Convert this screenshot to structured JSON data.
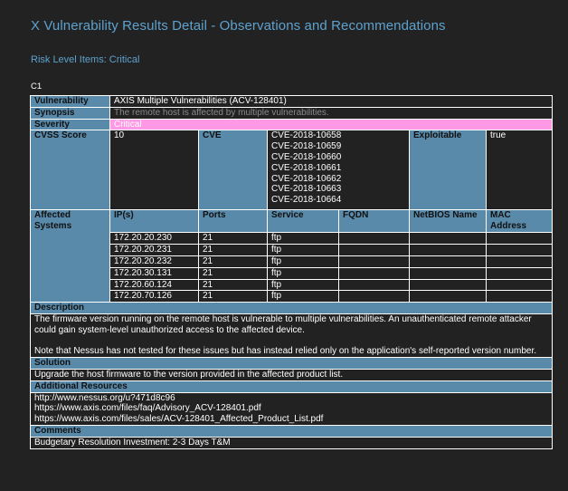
{
  "header": {
    "title": "X Vulnerability Results Detail - Observations and Recommendations",
    "subtitle": "Risk Level Items: Critical",
    "item_id": "C1"
  },
  "vuln": {
    "vulnerability_label": "Vulnerability",
    "vulnerability_value": "AXIS Multiple Vulnerabilities (ACV-128401)",
    "synopsis_label": "Synopsis",
    "synopsis_value": "The remote host is affected by multiple vulnerabilities.",
    "severity_label": "Severity",
    "severity_value": "Critical",
    "severity_color": "#ff99e6",
    "cvss_label": "CVSS Score",
    "cvss_value": "10",
    "cve_label": "CVE",
    "cves": [
      "CVE-2018-10658",
      "CVE-2018-10659",
      "CVE-2018-10660",
      "CVE-2018-10661",
      "CVE-2018-10662",
      "CVE-2018-10663",
      "CVE-2018-10664"
    ],
    "exploitable_label": "Exploitable",
    "exploitable_value": "true"
  },
  "systems": {
    "label": "Affected Systems",
    "columns": [
      "IP(s)",
      "Ports",
      "Service",
      "FQDN",
      "NetBIOS Name",
      "MAC Address"
    ],
    "rows": [
      {
        "ip": "172.20.20.230",
        "port": "21",
        "service": "ftp"
      },
      {
        "ip": "172.20.20.231",
        "port": "21",
        "service": "ftp"
      },
      {
        "ip": "172.20.20.232",
        "port": "21",
        "service": "ftp"
      },
      {
        "ip": "172.20.30.131",
        "port": "21",
        "service": "ftp"
      },
      {
        "ip": "172.20.60.124",
        "port": "21",
        "service": "ftp"
      },
      {
        "ip": "172.20.70.126",
        "port": "21",
        "service": "ftp"
      }
    ]
  },
  "description": {
    "label": "Description",
    "para1": "The firmware version running on the remote host is vulnerable to multiple vulnerabilities. An unauthenticated remote attacker could gain system-level unauthorized access to the affected device.",
    "para2": "Note that Nessus has not tested for these issues but has instead relied only on the application's self-reported version number."
  },
  "solution": {
    "label": "Solution",
    "text": "Upgrade the host firmware to the version provided in the affected product list."
  },
  "resources": {
    "label": "Additional Resources",
    "links": [
      "http://www.nessus.org/u?471d8c96",
      "https://www.axis.com/files/faq/Advisory_ACV-128401.pdf",
      "https://www.axis.com/files/sales/ACV-128401_Affected_Product_List.pdf"
    ]
  },
  "comments": {
    "label": "Comments",
    "text": "Budgetary Resolution Investment: 2-3 Days T&M"
  },
  "colors": {
    "background": "#222222",
    "heading": "#5da2cf",
    "label_fill": "#5a8aaa"
  }
}
